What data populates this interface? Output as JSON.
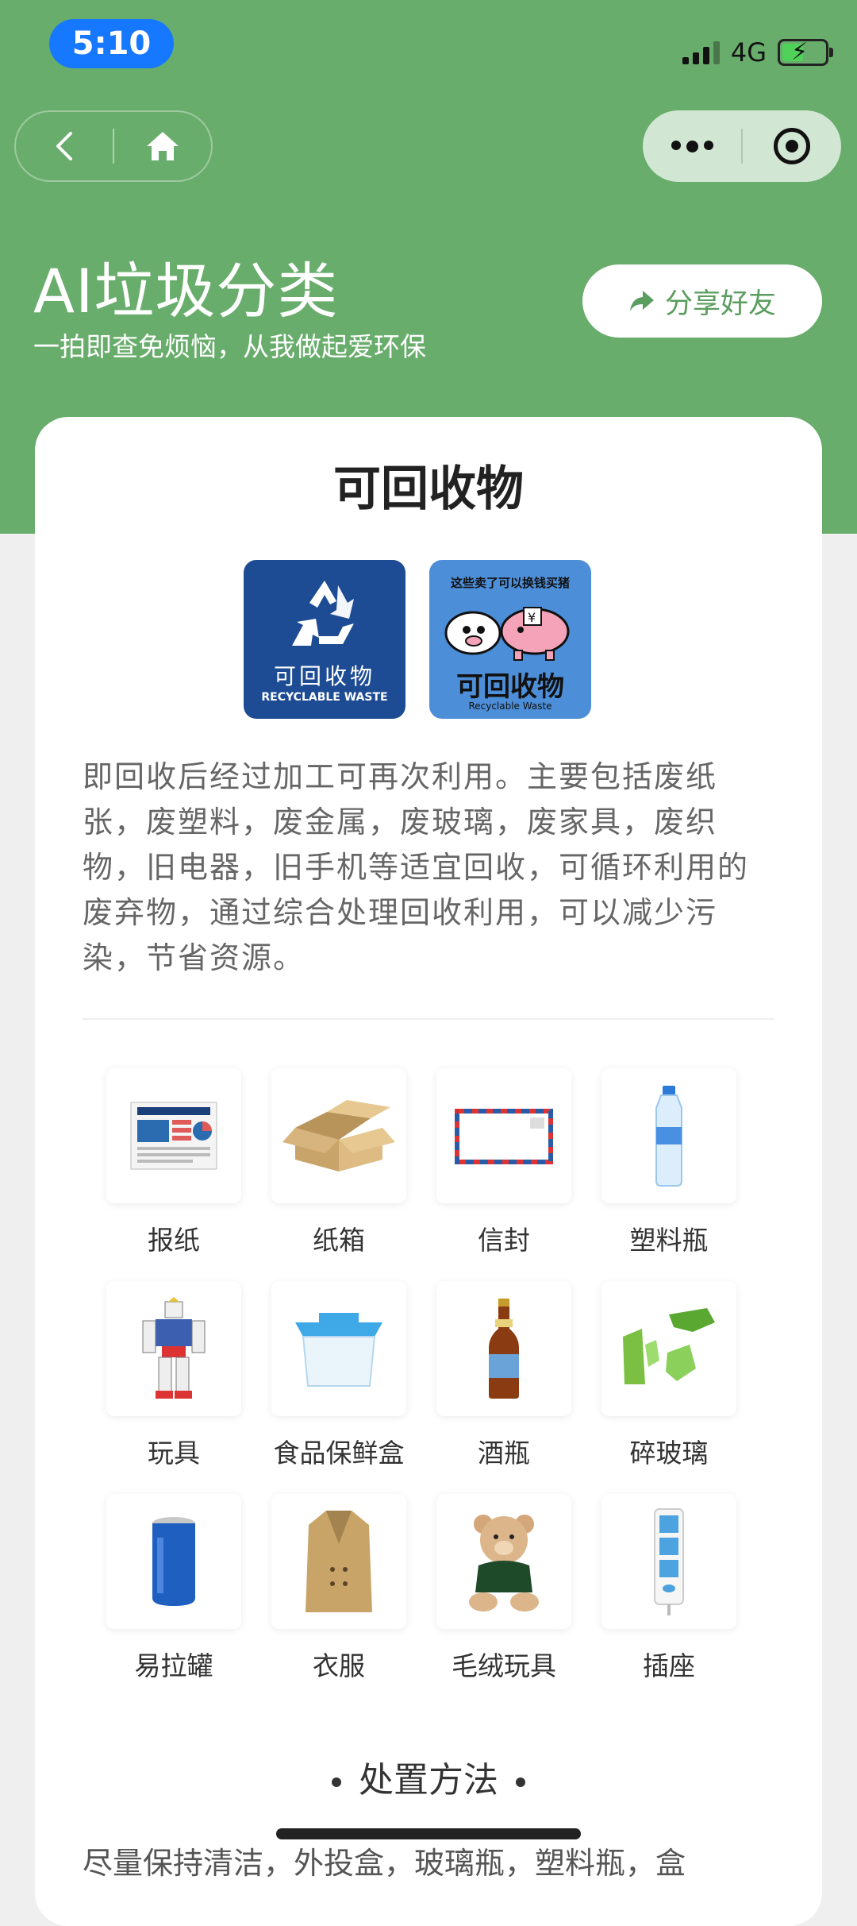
{
  "status_bar": {
    "time": "5:10",
    "network": "4G"
  },
  "nav": {},
  "header": {
    "title": "AI垃圾分类",
    "subtitle": "一拍即查免烦恼，从我做起爱环保",
    "share_label": "分享好友"
  },
  "card": {
    "title": "可回收物",
    "badge1": {
      "cn": "可回收物",
      "en": "RECYCLABLE WASTE"
    },
    "badge2": {
      "top": "这些卖了可以换钱买猪",
      "cn": "可回收物",
      "en": "Recyclable Waste"
    },
    "description": "即回收后经过加工可再次利用。主要包括废纸张，废塑料，废金属，废玻璃，废家具，废织物，旧电器，旧手机等适宜回收，可循环利用的废弃物，通过综合处理回收利用，可以减少污染，节省资源。",
    "items": [
      {
        "label": "报纸",
        "icon": "newspaper-icon"
      },
      {
        "label": "纸箱",
        "icon": "box-icon"
      },
      {
        "label": "信封",
        "icon": "envelope-icon"
      },
      {
        "label": "塑料瓶",
        "icon": "plastic-bottle-icon"
      },
      {
        "label": "玩具",
        "icon": "robot-toy-icon"
      },
      {
        "label": "食品保鲜盒",
        "icon": "food-container-icon"
      },
      {
        "label": "酒瓶",
        "icon": "beer-bottle-icon"
      },
      {
        "label": "碎玻璃",
        "icon": "broken-glass-icon"
      },
      {
        "label": "易拉罐",
        "icon": "can-icon"
      },
      {
        "label": "衣服",
        "icon": "coat-icon"
      },
      {
        "label": "毛绒玩具",
        "icon": "teddy-bear-icon"
      },
      {
        "label": "插座",
        "icon": "power-strip-icon"
      }
    ],
    "section_title": "处置方法",
    "method_text_partial": "尽量保持清洁，外投盒，玻璃瓶，塑料瓶，盒"
  },
  "colors": {
    "header_green": "#69ad6c",
    "accent_green": "#5a9d5e",
    "badge_blue": "#1d4c94"
  }
}
